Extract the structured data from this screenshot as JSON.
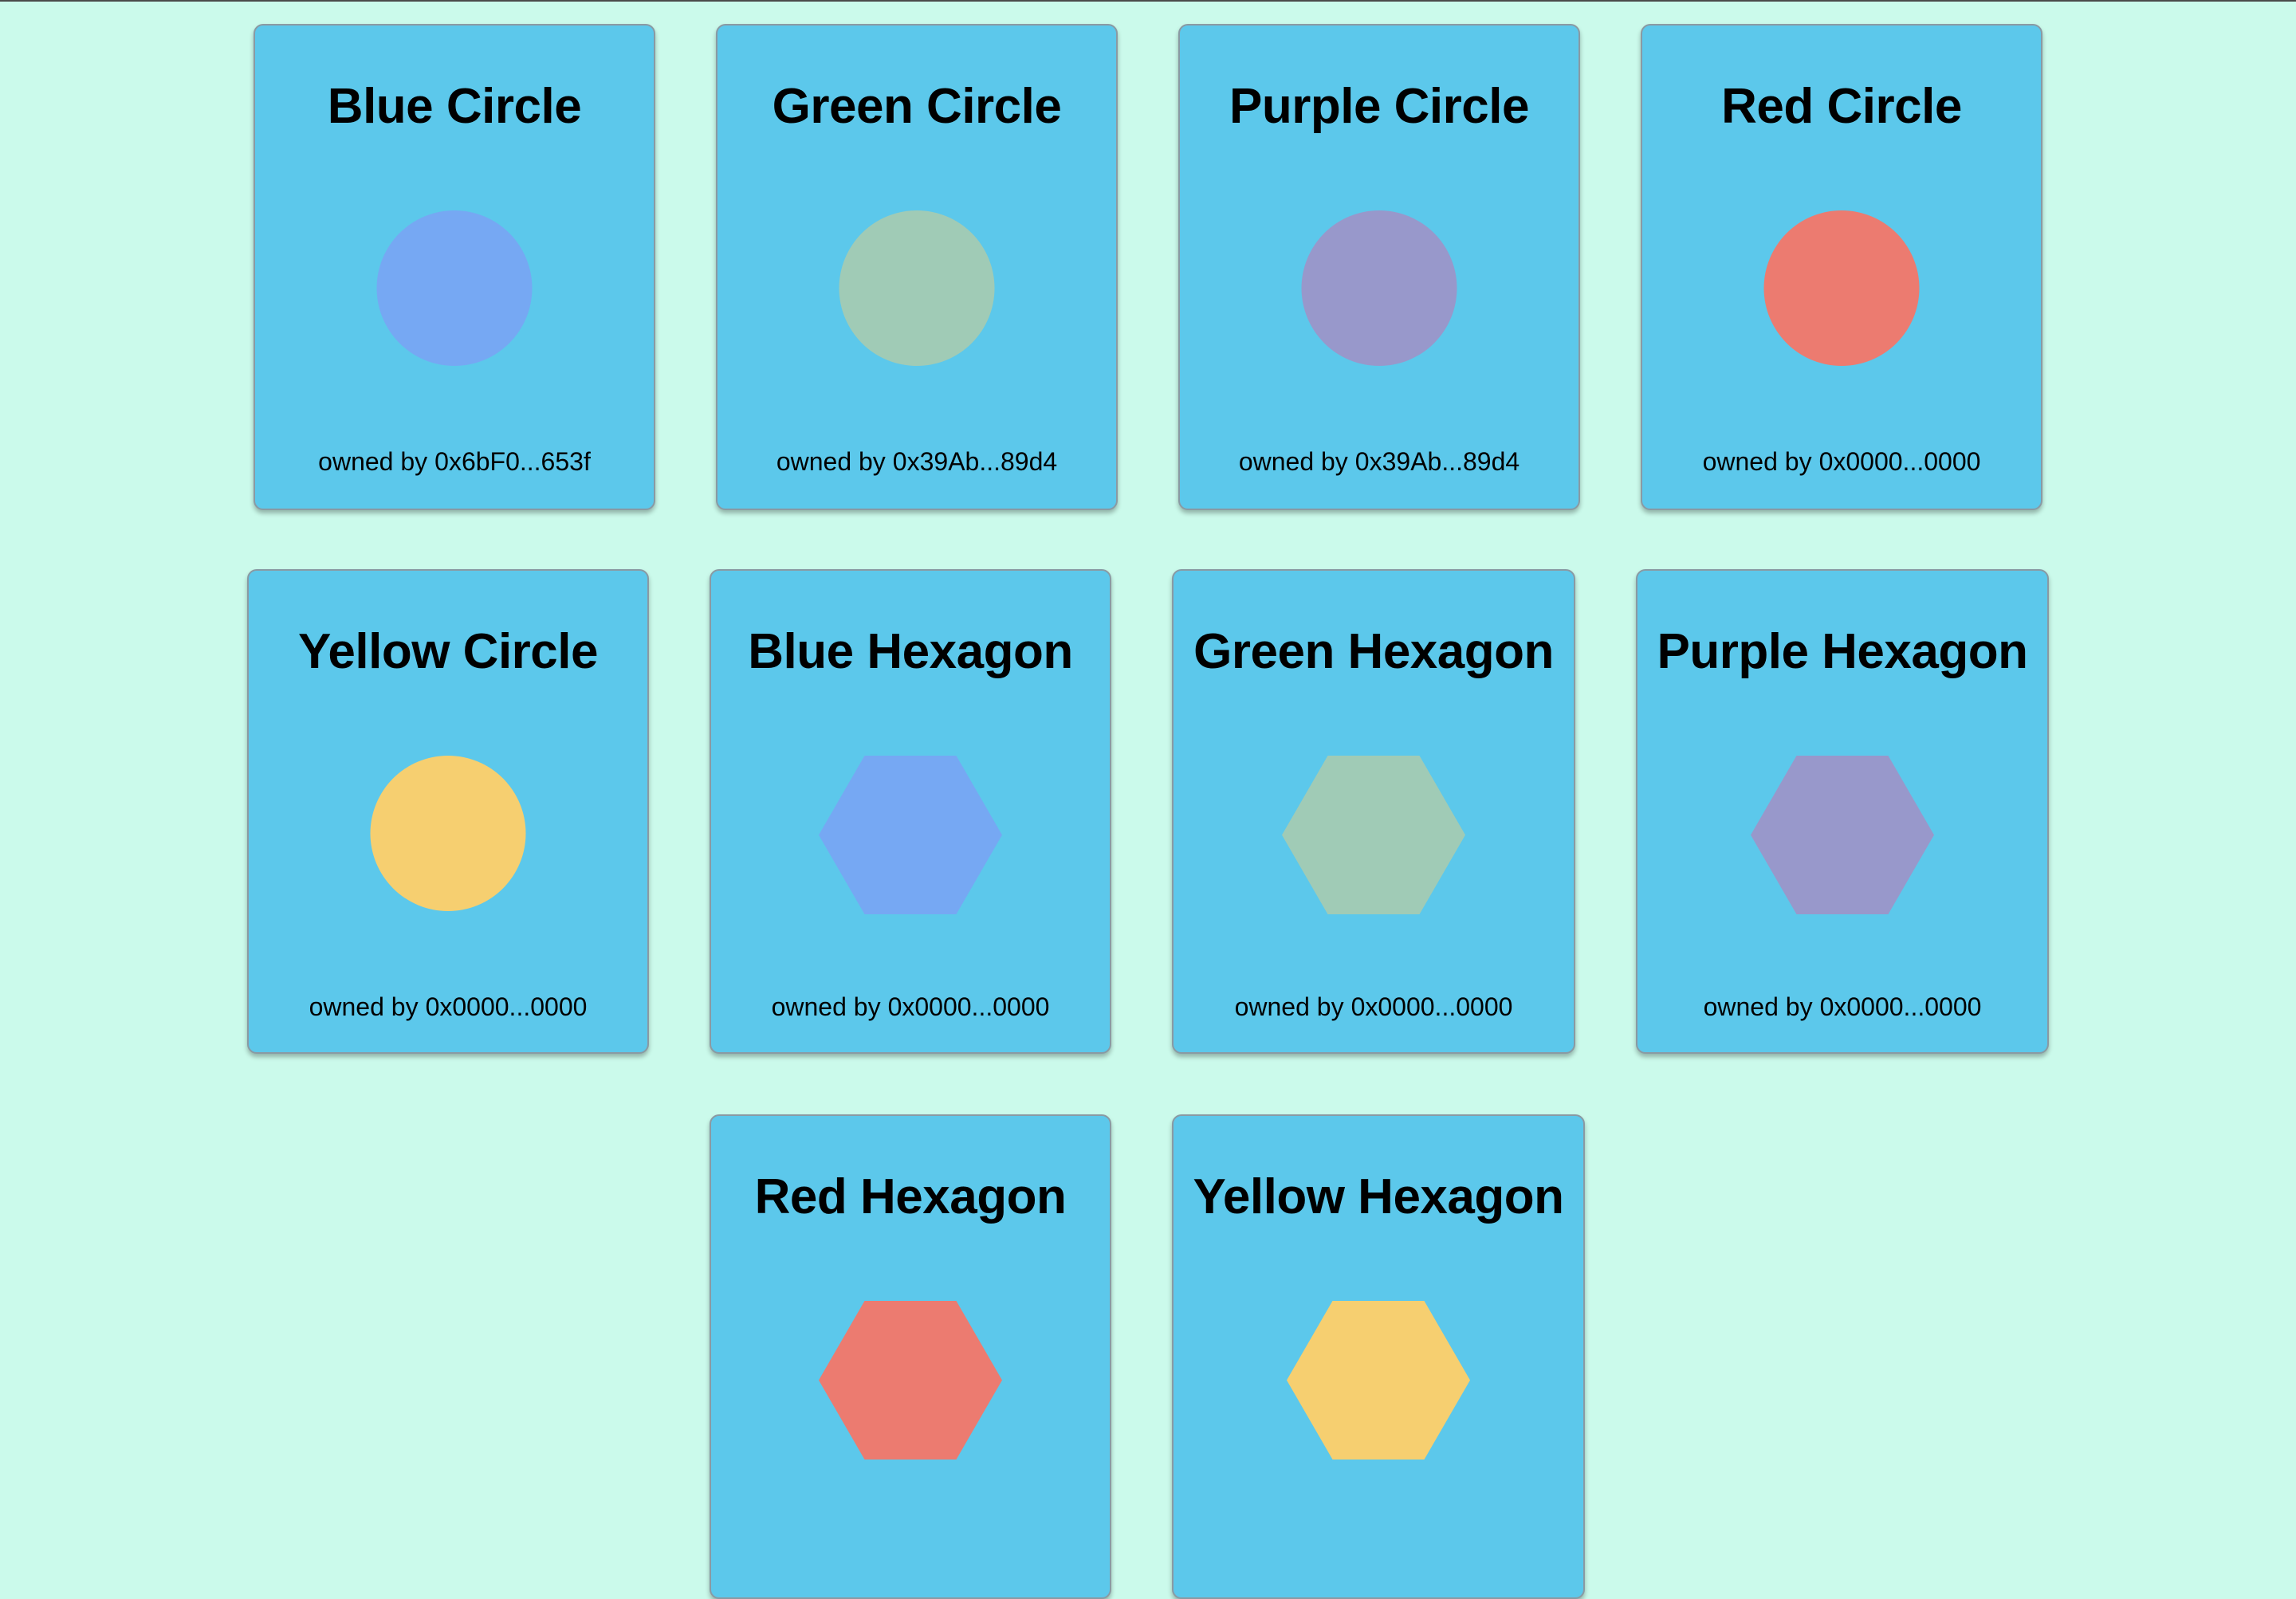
{
  "colors": {
    "page_background": "#cbfaeb",
    "card_background": "#5cc8eb",
    "blue": "#76a8f3",
    "green": "#a0cbb6",
    "purple": "#9898cb",
    "red": "#ec7b70",
    "yellow": "#f6cf70"
  },
  "owner_prefix": "owned by",
  "cards": [
    {
      "title": "Blue Circle",
      "shape": "circle",
      "color_name": "blue",
      "owner": "0x6bF0...653f"
    },
    {
      "title": "Green Circle",
      "shape": "circle",
      "color_name": "green",
      "owner": "0x39Ab...89d4"
    },
    {
      "title": "Purple Circle",
      "shape": "circle",
      "color_name": "purple",
      "owner": "0x39Ab...89d4"
    },
    {
      "title": "Red Circle",
      "shape": "circle",
      "color_name": "red",
      "owner": "0x0000...0000"
    },
    {
      "title": "Yellow Circle",
      "shape": "circle",
      "color_name": "yellow",
      "owner": "0x0000...0000"
    },
    {
      "title": "Blue Hexagon",
      "shape": "hexagon",
      "color_name": "blue",
      "owner": "0x0000...0000"
    },
    {
      "title": "Green Hexagon",
      "shape": "hexagon",
      "color_name": "green",
      "owner": "0x0000...0000"
    },
    {
      "title": "Purple Hexagon",
      "shape": "hexagon",
      "color_name": "purple",
      "owner": "0x0000...0000"
    },
    {
      "title": "Red Hexagon",
      "shape": "hexagon",
      "color_name": "red"
    },
    {
      "title": "Yellow Hexagon",
      "shape": "hexagon",
      "color_name": "yellow"
    }
  ]
}
